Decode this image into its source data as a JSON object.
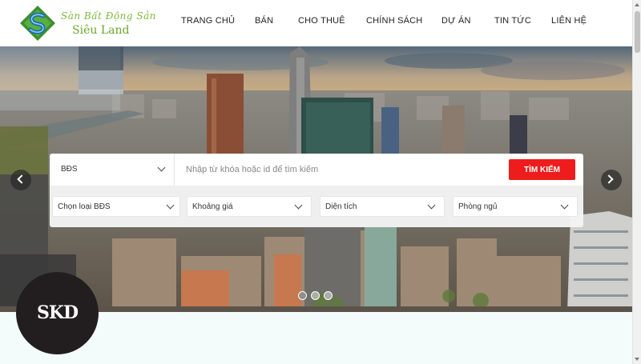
{
  "brand": {
    "line1": "Sàn Bất Động Sản",
    "line2": "Siêu Land",
    "colors": {
      "primary_green": "#6aa82c",
      "accent_red": "#ee1c1c"
    }
  },
  "nav": {
    "items": [
      "TRANG CHỦ",
      "BÁN",
      "CHO THUÊ",
      "CHÍNH SÁCH",
      "DỰ ÁN",
      "TIN TỨC",
      "LIÊN HỆ"
    ]
  },
  "search": {
    "category": "BĐS",
    "placeholder": "Nhập từ khóa hoặc id để tìm kiếm",
    "button": "TÌM KIẾM",
    "filters": [
      "Chọn loại BĐS",
      "Khoảng giá",
      "Diện tích",
      "Phòng ngủ"
    ]
  },
  "slider": {
    "slide_count": 3,
    "active_index": 0
  },
  "badge": {
    "text": "SKD"
  }
}
